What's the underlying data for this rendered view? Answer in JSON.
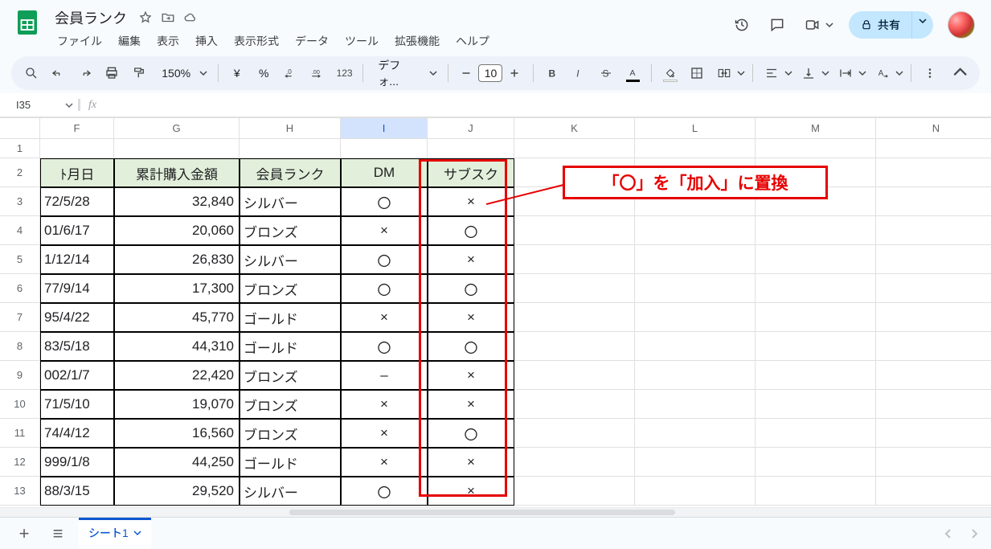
{
  "doc": {
    "title": "会員ランク"
  },
  "menus": [
    "ファイル",
    "編集",
    "表示",
    "挿入",
    "表示形式",
    "データ",
    "ツール",
    "拡張機能",
    "ヘルプ"
  ],
  "toolbar": {
    "zoom": "150%",
    "currency": "¥",
    "percent": "%",
    "dec_dec": ".0",
    "dec_inc": ".00",
    "numfmt": "123",
    "font": "デフォ...",
    "fontsize": "10"
  },
  "share": {
    "label": "共有"
  },
  "namebox": "I35",
  "formula": "",
  "columns": [
    "F",
    "G",
    "H",
    "I",
    "J",
    "K",
    "L",
    "M",
    "N"
  ],
  "selected_col": "I",
  "row_numbers": [
    1,
    2,
    3,
    4,
    5,
    6,
    7,
    8,
    9,
    10,
    11,
    12,
    13
  ],
  "headers": {
    "F": "ﾄ月日",
    "G": "累計購入金額",
    "H": "会員ランク",
    "I": "DM",
    "J": "サブスク"
  },
  "rows": [
    {
      "F": "72/5/28",
      "G": "32,840",
      "H": "シルバー",
      "I": "〇",
      "J": "×"
    },
    {
      "F": "01/6/17",
      "G": "20,060",
      "H": "ブロンズ",
      "I": "×",
      "J": "〇"
    },
    {
      "F": "1/12/14",
      "G": "26,830",
      "H": "シルバー",
      "I": "〇",
      "J": "×"
    },
    {
      "F": "77/9/14",
      "G": "17,300",
      "H": "ブロンズ",
      "I": "〇",
      "J": "〇"
    },
    {
      "F": "95/4/22",
      "G": "45,770",
      "H": "ゴールド",
      "I": "×",
      "J": "×"
    },
    {
      "F": "83/5/18",
      "G": "44,310",
      "H": "ゴールド",
      "I": "〇",
      "J": "〇"
    },
    {
      "F": "002/1/7",
      "G": "22,420",
      "H": "ブロンズ",
      "I": "–",
      "J": "×"
    },
    {
      "F": "71/5/10",
      "G": "19,070",
      "H": "ブロンズ",
      "I": "×",
      "J": "×"
    },
    {
      "F": "74/4/12",
      "G": "16,560",
      "H": "ブロンズ",
      "I": "×",
      "J": "〇"
    },
    {
      "F": "999/1/8",
      "G": "44,250",
      "H": "ゴールド",
      "I": "×",
      "J": "×"
    },
    {
      "F": "88/3/15",
      "G": "29,520",
      "H": "シルバー",
      "I": "〇",
      "J": "×"
    }
  ],
  "annotation": "「〇」を「加入」に置換",
  "tabs": {
    "sheet1": "シート1"
  }
}
